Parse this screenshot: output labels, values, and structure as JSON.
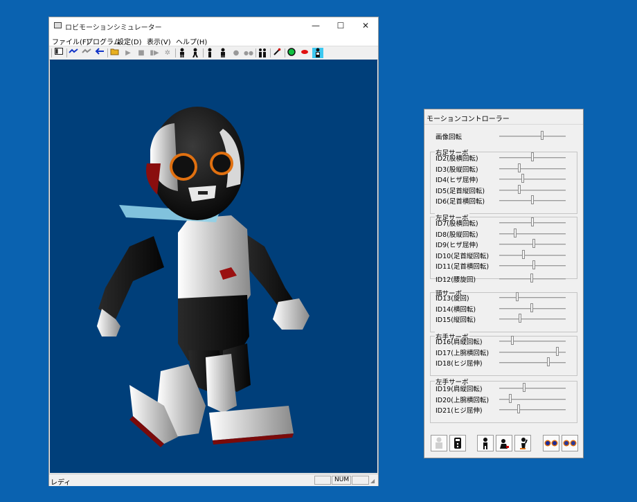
{
  "main_window": {
    "title": "ロビモーションシミュレーター",
    "controls": {
      "minimize": "—",
      "maximize": "☐",
      "close": "✕"
    },
    "menu": [
      "ファイル(F)",
      "プログラム",
      "設定(D)",
      "表示(V)",
      "ヘルプ(H)"
    ],
    "status": {
      "text": "レディ",
      "num": "NUM"
    }
  },
  "toolbar_icons": [
    "panel-icon",
    "wave-icon",
    "wave-alt-icon",
    "arrow-left-icon",
    "open-folder-icon",
    "play-icon",
    "stop-icon",
    "step-icon",
    "bug-icon",
    "robot-stand-icon",
    "robot-walk-icon",
    "robot-pose-icon",
    "robot-side-icon",
    "dot-icon",
    "double-dot-icon",
    "robot-pair-icon",
    "pen-icon",
    "green-circle-icon",
    "red-oval-icon",
    "robot-head-icon"
  ],
  "motion_controller": {
    "title": "モーションコントローラー",
    "image_rotation": {
      "label": "画像回転",
      "value": 0.65
    },
    "groups": [
      {
        "title": "右足サーボ",
        "sliders": [
          {
            "label": "ID2(股横回転)",
            "value": 0.5
          },
          {
            "label": "ID3(股縦回転)",
            "value": 0.3
          },
          {
            "label": "ID4(ヒザ屈伸)",
            "value": 0.35
          },
          {
            "label": "ID5(足首縦回転)",
            "value": 0.3
          },
          {
            "label": "ID6(足首横回転)",
            "value": 0.5
          }
        ]
      },
      {
        "title": "左足サーボ",
        "sliders": [
          {
            "label": "ID7(股横回転)",
            "value": 0.5
          },
          {
            "label": "ID8(股縦回転)",
            "value": 0.24
          },
          {
            "label": "ID9(ヒザ屈伸)",
            "value": 0.52
          },
          {
            "label": "ID10(足首縦回転)",
            "value": 0.36
          },
          {
            "label": "ID11(足首横回転)",
            "value": 0.52
          }
        ]
      },
      {
        "title": "",
        "sliders": [
          {
            "label": "ID12(腰旋回)",
            "value": 0.49
          }
        ]
      },
      {
        "title": "頭サーボ",
        "sliders": [
          {
            "label": "ID13(旋回)",
            "value": 0.27
          },
          {
            "label": "ID14(横回転)",
            "value": 0.49
          },
          {
            "label": "ID15(縦回転)",
            "value": 0.31
          }
        ]
      },
      {
        "title": "右手サーボ",
        "sliders": [
          {
            "label": "ID16(肩縦回転)",
            "value": 0.2
          },
          {
            "label": "ID17(上腕横回転)",
            "value": 0.88
          },
          {
            "label": "ID18(ヒジ屈伸)",
            "value": 0.74
          }
        ]
      },
      {
        "title": "左手サーボ",
        "sliders": [
          {
            "label": "ID19(肩縦回転)",
            "value": 0.38
          },
          {
            "label": "ID20(上腕横回転)",
            "value": 0.17
          },
          {
            "label": "ID21(ヒジ屈伸)",
            "value": 0.29
          }
        ]
      }
    ],
    "bottom_buttons": [
      "robot-silhouette-icon",
      "remote-control-icon",
      "robot-stand-icon",
      "robot-bow-icon",
      "robot-arm-icon",
      "eyes-icon",
      "eyes-alt-icon"
    ]
  }
}
